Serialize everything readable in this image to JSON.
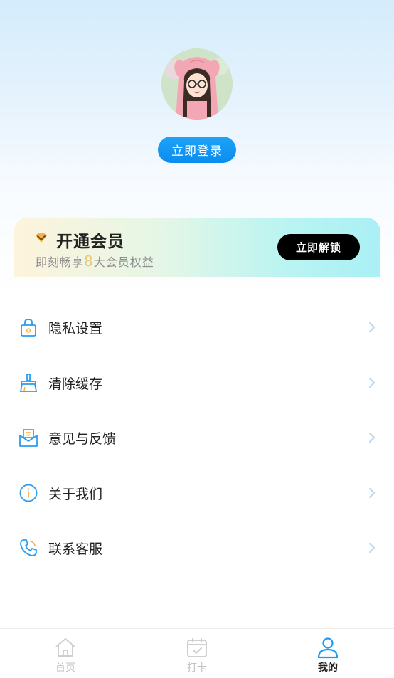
{
  "profile": {
    "login_label": "立即登录"
  },
  "vip": {
    "title": "开通会员",
    "subtitle_prefix": "即刻畅享",
    "subtitle_number": "8",
    "subtitle_suffix": "大会员权益",
    "unlock_label": "立即解锁"
  },
  "menu": {
    "items": [
      {
        "label": "隐私设置",
        "icon": "lock-icon"
      },
      {
        "label": "清除缓存",
        "icon": "broom-icon"
      },
      {
        "label": "意见与反馈",
        "icon": "feedback-envelope-icon"
      },
      {
        "label": "关于我们",
        "icon": "info-icon"
      },
      {
        "label": "联系客服",
        "icon": "phone-icon"
      }
    ]
  },
  "tabbar": {
    "tabs": [
      {
        "label": "首页",
        "icon": "home-icon",
        "active": false
      },
      {
        "label": "打卡",
        "icon": "calendar-check-icon",
        "active": false
      },
      {
        "label": "我的",
        "icon": "user-icon",
        "active": true
      }
    ]
  },
  "colors": {
    "accent": "#1a9af2",
    "icon_blue": "#2a9cf0",
    "vip_number": "#e9c878",
    "tab_inactive": "#c2c2c2"
  }
}
